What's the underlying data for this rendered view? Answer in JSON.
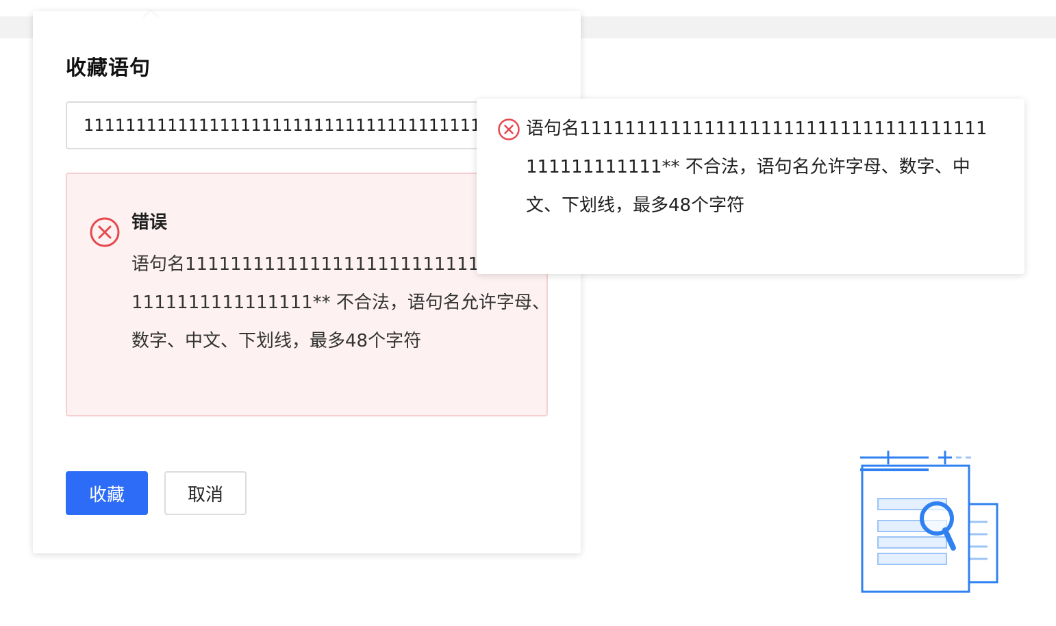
{
  "popover": {
    "title": "收藏语句",
    "name_input_value": "111111111111111111111111111111111111111111111111",
    "error": {
      "icon": "close-circle-icon",
      "title": "错误",
      "message": "语句名111111111111111111111111111111111111111111111111** 不合法，语句名允许字母、数字、中文、下划线，最多48个字符"
    },
    "buttons": {
      "confirm_label": "收藏",
      "cancel_label": "取消"
    }
  },
  "tooltip": {
    "icon": "close-circle-icon",
    "message": "语句名111111111111111111111111111111111111111111111111** 不合法，语句名允许字母、数字、中文、下划线，最多48个字符"
  },
  "colors": {
    "primary": "#2d6cf6",
    "error": "#e5484d",
    "error_bg": "#fdf1f1",
    "error_border": "#f6cfd0",
    "illustration": "#2f80f0"
  },
  "illustration": {
    "icon": "document-search-icon"
  }
}
